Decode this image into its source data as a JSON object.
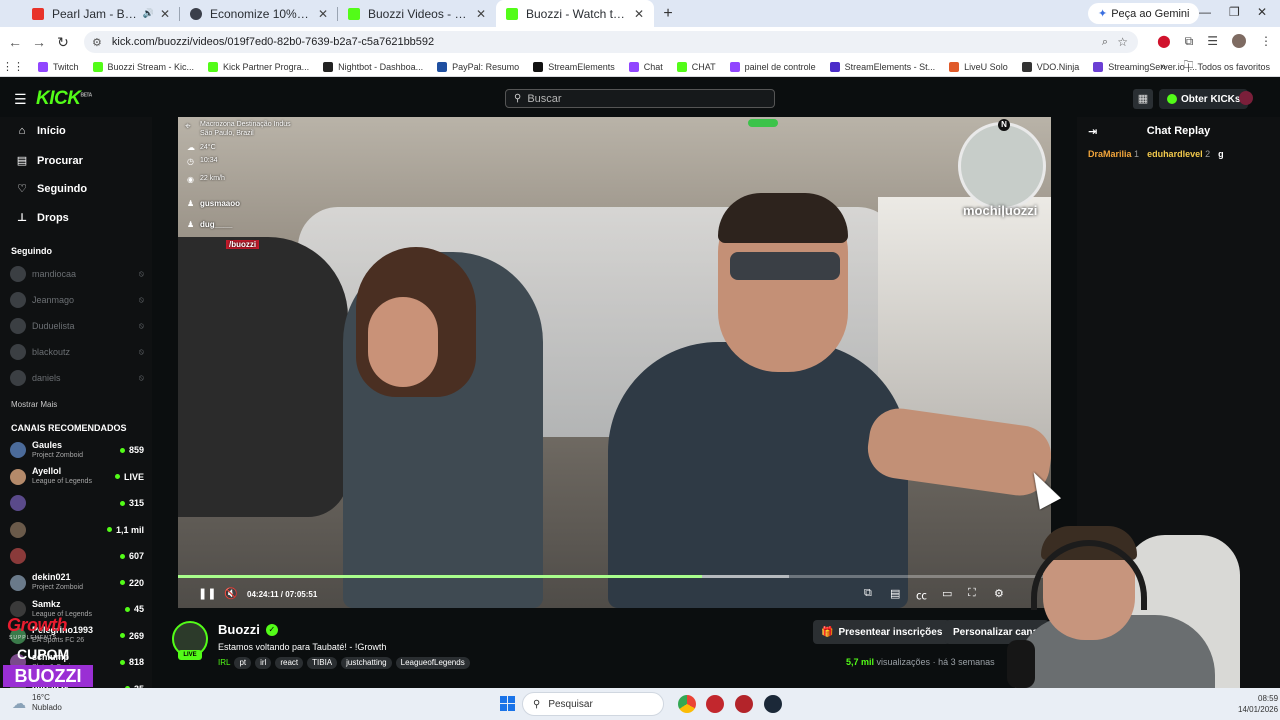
{
  "browser": {
    "tabs": [
      {
        "title": "Pearl Jam - Black (Official A",
        "favicon_color": "#e8332a",
        "extra": "🔊"
      },
      {
        "title": "Economize 10% em ReStory: Cr",
        "favicon_color": "#3b3f4a",
        "extra": ""
      },
      {
        "title": "Buozzi Videos - Watch On-Dem",
        "favicon_color": "#53fc18",
        "extra": ""
      },
      {
        "title": "Buozzi - Watch the VOD on Kic",
        "favicon_color": "#53fc18",
        "extra": ""
      }
    ],
    "gemini_label": "Peça ao Gemini",
    "url": "kick.com/buozzi/videos/019f7ed0-82b0-7639-b2a7-c5a7621bb592",
    "bookmarks": [
      {
        "label": "Twitch",
        "color": "#9146ff"
      },
      {
        "label": "Buozzi Stream - Kic...",
        "color": "#53fc18"
      },
      {
        "label": "Kick Partner Progra...",
        "color": "#53fc18"
      },
      {
        "label": "Nightbot - Dashboa...",
        "color": "#222222"
      },
      {
        "label": "PayPal: Resumo",
        "color": "#1f4fa0"
      },
      {
        "label": "StreamElements",
        "color": "#111111"
      },
      {
        "label": "Chat",
        "color": "#9146ff"
      },
      {
        "label": "CHAT",
        "color": "#53fc18"
      },
      {
        "label": "painel de controle",
        "color": "#9146ff"
      },
      {
        "label": "StreamElements - St...",
        "color": "#4a2cc9"
      },
      {
        "label": "LiveU Solo",
        "color": "#e05a2a"
      },
      {
        "label": "VDO.Ninja",
        "color": "#333333"
      },
      {
        "label": "StreamingServer.io |...",
        "color": "#6b3fd4"
      }
    ],
    "all_bookmarks_label": "Todos os favoritos"
  },
  "kick": {
    "logo_text": "KICK",
    "logo_sup": "BETA",
    "search_placeholder": "Buscar",
    "kicks_label": "Obter KICKs",
    "nav": [
      {
        "label": "Início",
        "icon": "home-icon",
        "glyph": "⌂"
      },
      {
        "label": "Procurar",
        "icon": "browse-icon",
        "glyph": "▤"
      },
      {
        "label": "Seguindo",
        "icon": "heart-icon",
        "glyph": "♡"
      },
      {
        "label": "Drops",
        "icon": "drops-icon",
        "glyph": "⊥"
      }
    ],
    "following_title": "Seguindo",
    "following": [
      "mandiocaa",
      "Jeanmago",
      "Duduelista",
      "blackoutz",
      "daniels"
    ],
    "show_more": "Mostrar Mais",
    "recommended_title": "CANAIS RECOMENDADOS",
    "recommended": [
      {
        "name": "Gaules",
        "category": "Project Zomboid",
        "count": "859",
        "color": "#4b6b9a"
      },
      {
        "name": "Ayellol",
        "category": "League of Legends",
        "count": "LIVE",
        "color": "#b48a6a"
      },
      {
        "name": "",
        "category": "",
        "count": "315",
        "color": "#5a4a8a"
      },
      {
        "name": "",
        "category": "",
        "count": "1,1 mil",
        "color": "#6a5a4a"
      },
      {
        "name": "",
        "category": "",
        "count": "607",
        "color": "#8a3a3a"
      },
      {
        "name": "dekin021",
        "category": "Project Zomboid",
        "count": "220",
        "color": "#6a7a8a"
      },
      {
        "name": "Samkz",
        "category": "League of Legends",
        "count": "45",
        "color": "#3a3a3a"
      },
      {
        "name": "Pelegrino1993",
        "category": "EA Sports FC 26",
        "count": "269",
        "color": "#3a7a4a"
      },
      {
        "name": "schlump",
        "category": "Slots & Casino",
        "count": "818",
        "color": "#7a4a8a"
      },
      {
        "name": "dersin2k",
        "category": "",
        "count": "35",
        "color": "#5a5a5a"
      }
    ],
    "ad": {
      "brand": "Growth",
      "sub": "SUPPLEMENTS",
      "coupon": "CUPOM",
      "code": "BUOZZI"
    }
  },
  "video": {
    "overlay": {
      "location": "Macrozona Destinação Indus",
      "city": "São Paulo, Brazil",
      "temp": "24°C",
      "time": "10:34",
      "speed": "22 km/h",
      "chat_users": [
        "gusmaaoo",
        "dug____",
        "/buozzi"
      ],
      "brand_tag": "mochiļuozzi"
    },
    "progress": 0.6,
    "time_display": "04:24:11 / 07:05:51"
  },
  "chat": {
    "title": "Chat Replay",
    "leaderboard": [
      {
        "name": "DraMarilia",
        "count": "1"
      },
      {
        "name": "eduhardlevel",
        "count": "2"
      },
      {
        "name": "g",
        "count": ""
      }
    ]
  },
  "stream": {
    "channel": "Buozzi",
    "live_badge": "LIVE",
    "title": "Estamos voltando para Taubaté! - !Growth",
    "tags": [
      "IRL",
      "pt",
      "irl",
      "react",
      "TIBIA",
      "justchatting",
      "LeagueofLegends"
    ],
    "subscribe_label": "Presentear inscrições",
    "customize_label": "Personalizar canal",
    "views": "5,7 mil",
    "views_suffix": "visualizações",
    "age": "há 3 semanas"
  },
  "taskbar": {
    "temp": "16°C",
    "weather": "Nublado",
    "search_placeholder": "Pesquisar",
    "time": "08:59",
    "date": "14/01/2026"
  }
}
